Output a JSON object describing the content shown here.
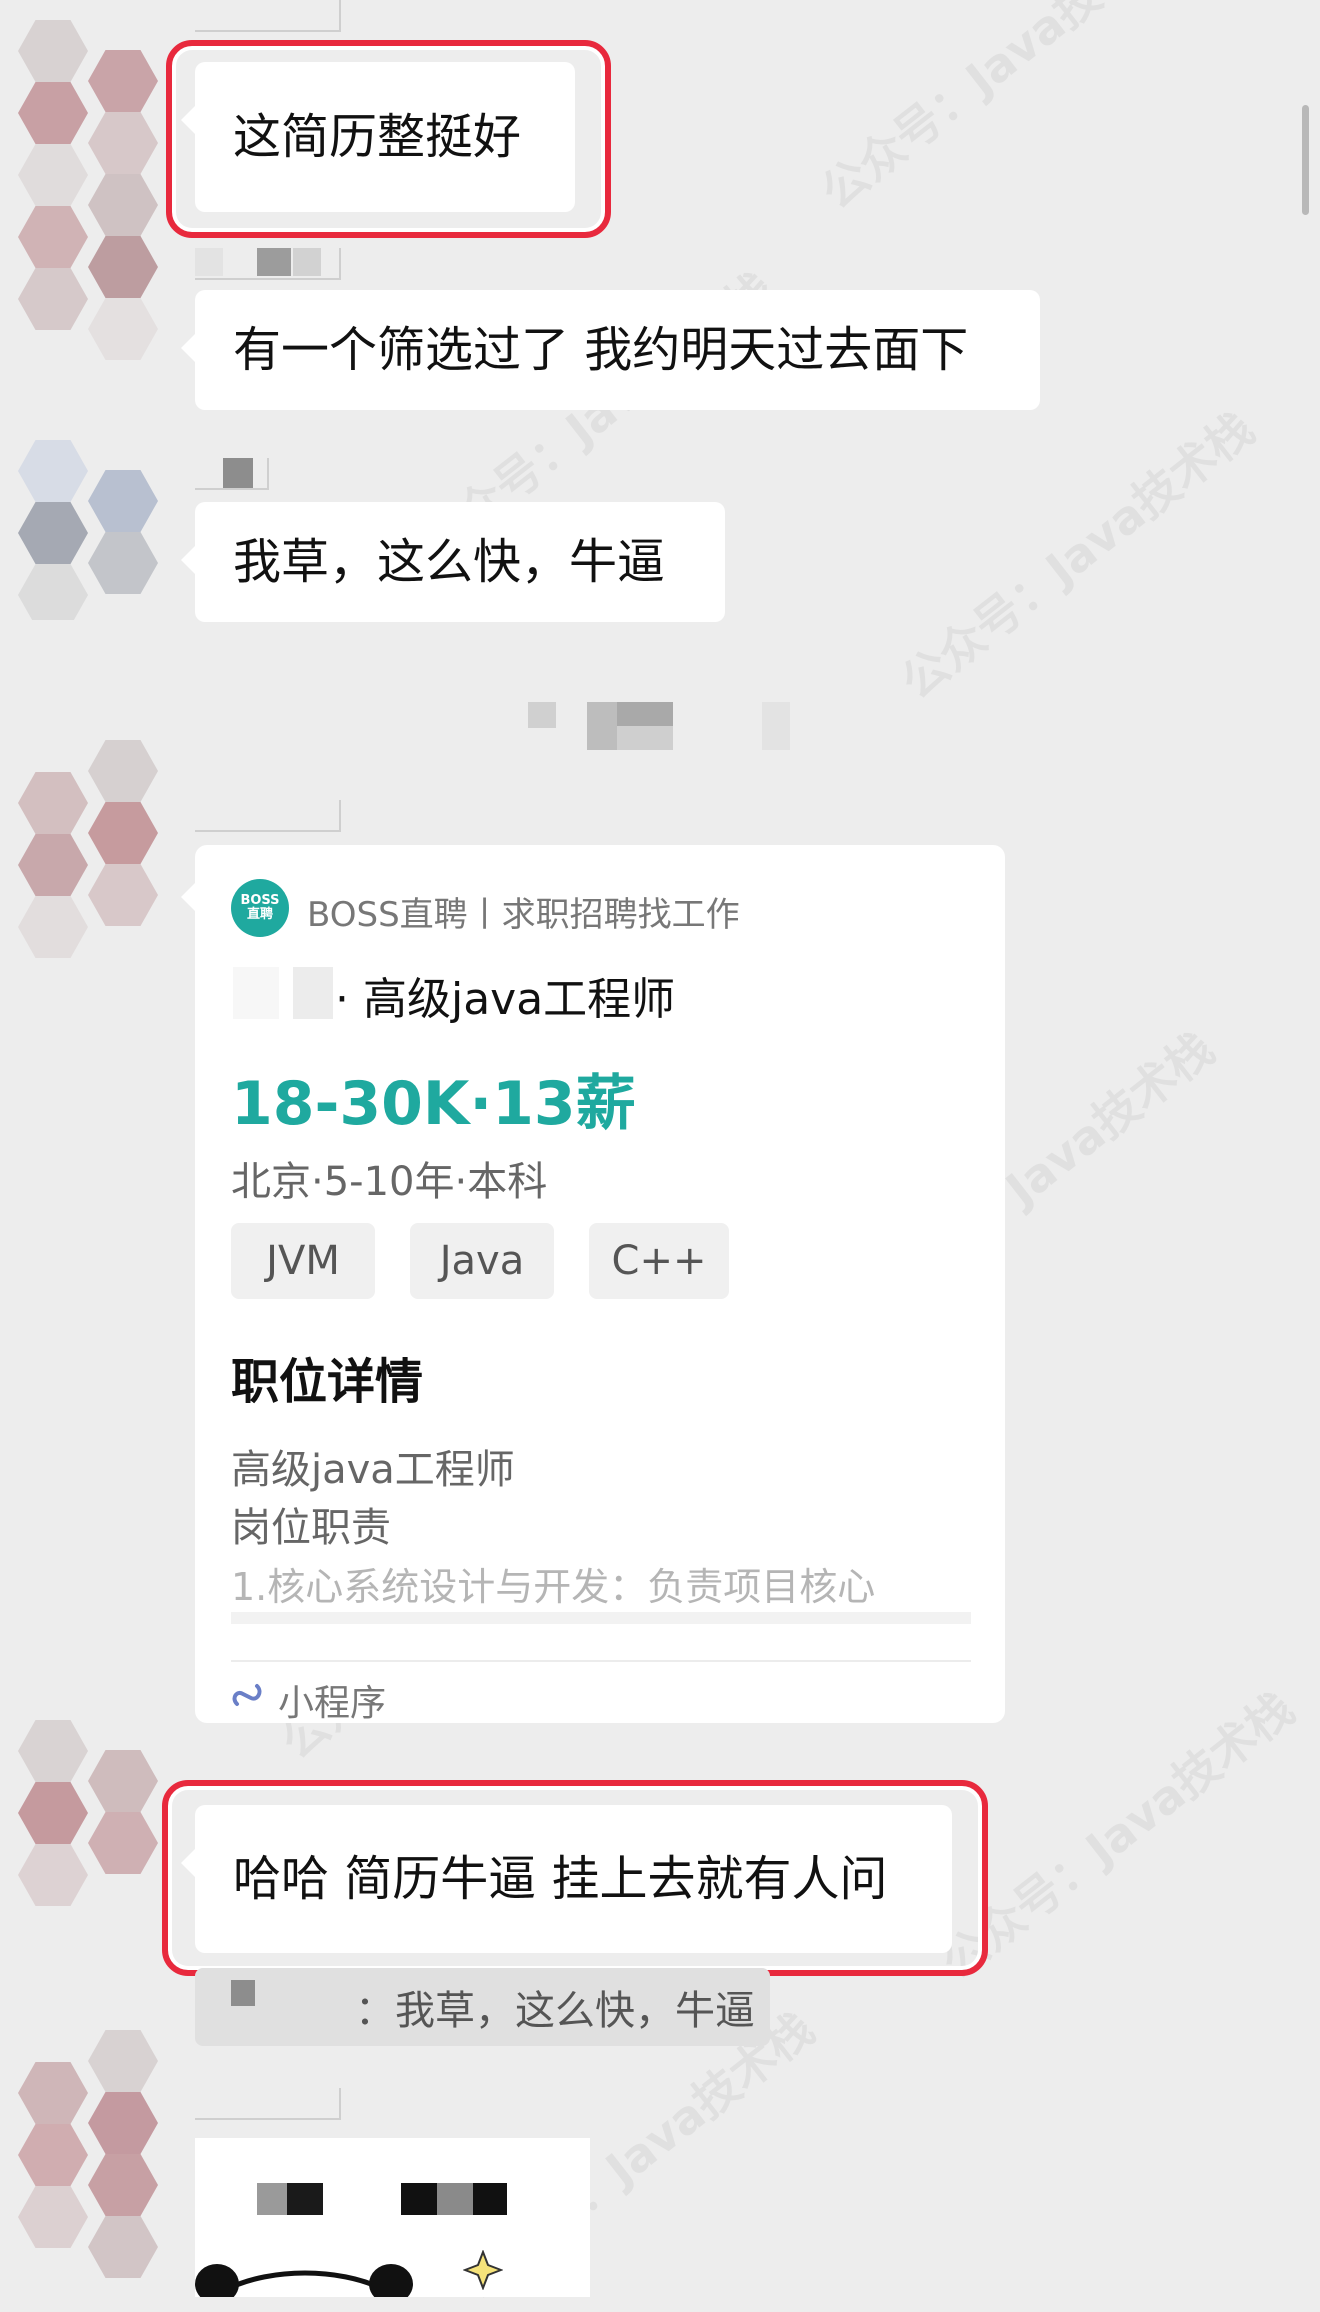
{
  "messages": {
    "m1": "这简历整挺好",
    "m2": "有一个筛选过了 我约明天过去面下",
    "m3": "我草，这么快，牛逼",
    "m4": "哈哈 简历牛逼 挂上去就有人问",
    "quote_text": "：我草，这么快，牛逼"
  },
  "card": {
    "app_name": "BOSS直聘丨求职招聘找工作",
    "logo_text_top": "BOSS",
    "logo_text_bottom": "直聘",
    "job_title": "· 高级java工程师",
    "salary": "18-30K·13薪",
    "meta": "北京·5-10年·本科",
    "tags": [
      "JVM",
      "Java",
      "C++"
    ],
    "section_title": "职位详情",
    "detail_line1": "高级java工程师",
    "detail_line2": "岗位职责",
    "detail_line3": "1.核心系统设计与开发：负责项目核心",
    "footer_label": "小程序",
    "accent": "#1fa99f"
  },
  "watermark": "公众号：Java技术栈",
  "colors": {
    "highlight": "#e8293d",
    "background": "#ededed"
  }
}
